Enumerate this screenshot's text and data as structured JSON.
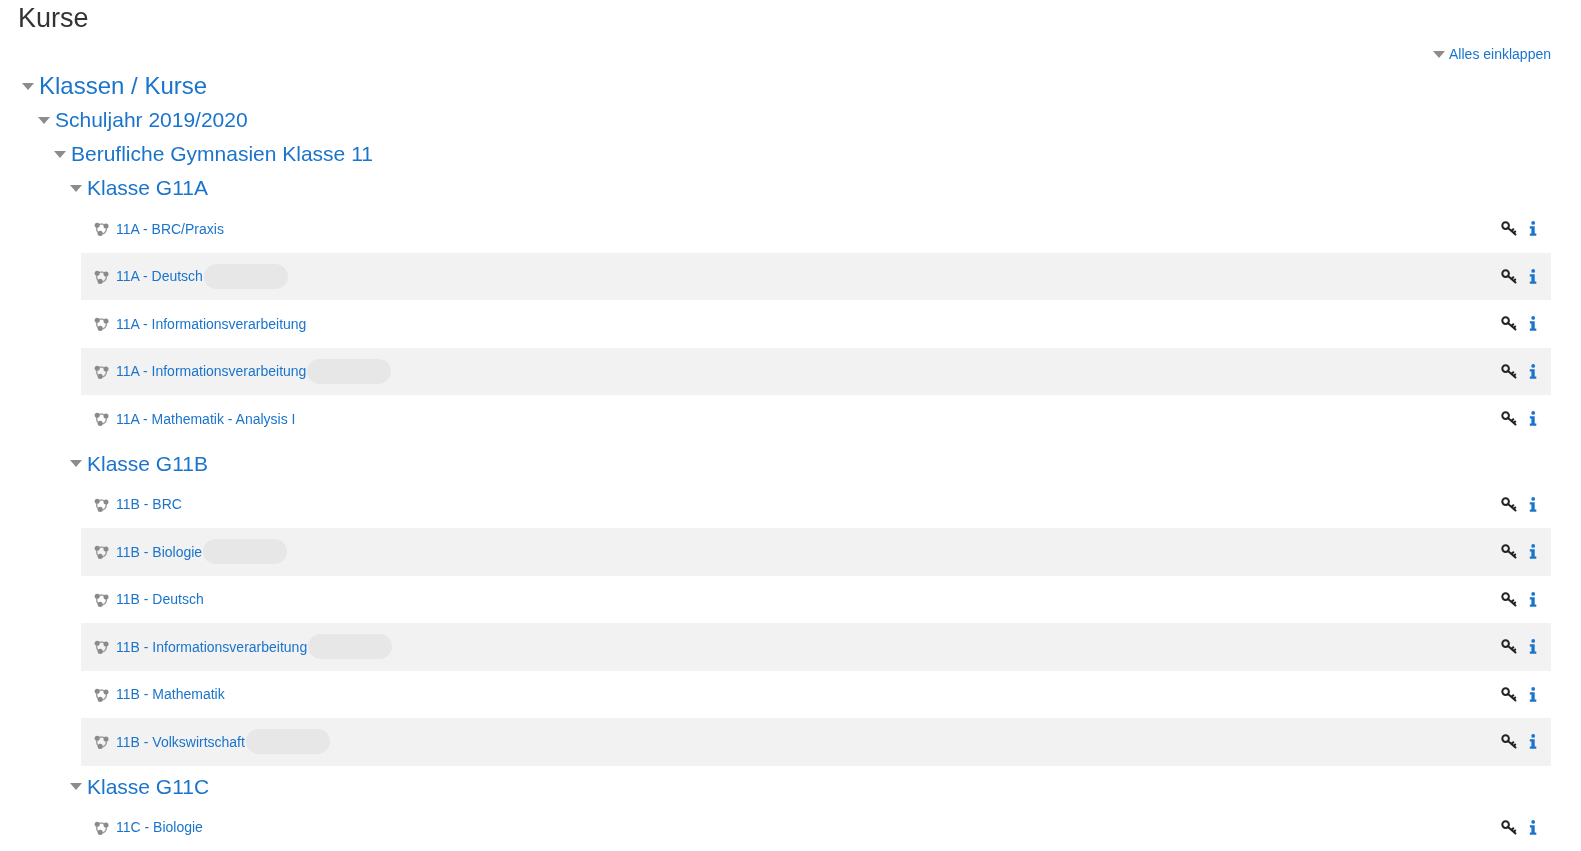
{
  "page": {
    "title": "Kurse"
  },
  "collapse_all": {
    "label": "Alles einklappen"
  },
  "tree": [
    {
      "label": "Klassen / Kurse",
      "expanded": true,
      "children": [
        {
          "label": "Schuljahr 2019/2020",
          "expanded": true,
          "children": [
            {
              "label": "Berufliche Gymnasien Klasse 11",
              "expanded": true,
              "children": [
                {
                  "label": "Klasse G11A",
                  "expanded": true,
                  "courses": [
                    {
                      "name": "11A - BRC/Praxis",
                      "redacted": false
                    },
                    {
                      "name": "11A - Deutsch",
                      "redacted": true
                    },
                    {
                      "name": "11A - Informationsverarbeitung",
                      "redacted": false
                    },
                    {
                      "name": "11A - Informationsverarbeitung",
                      "redacted": true
                    },
                    {
                      "name": "11A - Mathematik - Analysis I",
                      "redacted": false
                    }
                  ]
                },
                {
                  "label": "Klasse G11B",
                  "expanded": true,
                  "courses": [
                    {
                      "name": "11B - BRC",
                      "redacted": false
                    },
                    {
                      "name": "11B - Biologie",
                      "redacted": true
                    },
                    {
                      "name": "11B - Deutsch",
                      "redacted": false
                    },
                    {
                      "name": "11B - Informationsverarbeitung",
                      "redacted": true
                    },
                    {
                      "name": "11B - Mathematik",
                      "redacted": false
                    },
                    {
                      "name": "11B - Volkswirtschaft",
                      "redacted": true
                    }
                  ]
                },
                {
                  "label": "Klasse G11C",
                  "expanded": true,
                  "courses": [
                    {
                      "name": "11C - Biologie",
                      "redacted": false
                    }
                  ]
                }
              ]
            }
          ]
        }
      ]
    }
  ]
}
